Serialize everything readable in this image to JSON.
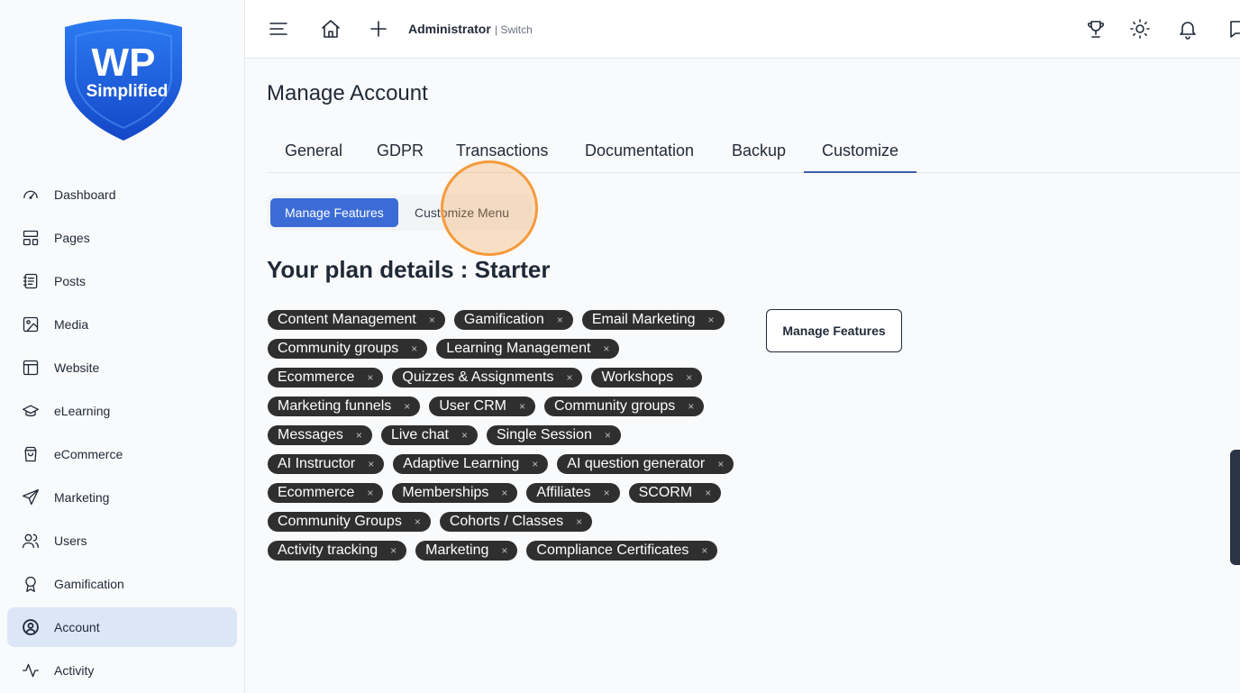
{
  "brand": {
    "logo_main": "WP",
    "logo_sub": "Simplified",
    "color": "#1f5fe0"
  },
  "sidebar": {
    "items": [
      {
        "label": "Dashboard",
        "icon": "gauge-icon"
      },
      {
        "label": "Pages",
        "icon": "layout-icon"
      },
      {
        "label": "Posts",
        "icon": "notebook-icon"
      },
      {
        "label": "Media",
        "icon": "image-icon"
      },
      {
        "label": "Website",
        "icon": "browser-icon"
      },
      {
        "label": "eLearning",
        "icon": "graduation-cap-icon"
      },
      {
        "label": "eCommerce",
        "icon": "shopping-bag-icon"
      },
      {
        "label": "Marketing",
        "icon": "paper-plane-icon"
      },
      {
        "label": "Users",
        "icon": "users-icon"
      },
      {
        "label": "Gamification",
        "icon": "award-icon"
      },
      {
        "label": "Account",
        "icon": "user-circle-icon",
        "active": true
      },
      {
        "label": "Activity",
        "icon": "activity-icon"
      }
    ]
  },
  "topbar": {
    "user": "Administrator",
    "switch_label": "| Switch"
  },
  "page": {
    "title": "Manage Account",
    "tabs": [
      {
        "label": "General"
      },
      {
        "label": "GDPR"
      },
      {
        "label": "Transactions"
      },
      {
        "label": "Documentation"
      },
      {
        "label": "Backup"
      },
      {
        "label": "Customize",
        "active": true
      }
    ],
    "subtabs": [
      {
        "label": "Manage Features",
        "active": true
      },
      {
        "label": "Customize Menu"
      }
    ],
    "plan_heading": "Your plan details : Starter",
    "features": [
      [
        "Content Management",
        "Gamification",
        "Email Marketing"
      ],
      [
        "Community groups",
        "Learning Management"
      ],
      [
        "Ecommerce",
        "Quizzes & Assignments",
        "Workshops"
      ],
      [
        "Marketing funnels",
        "User CRM",
        "Community groups"
      ],
      [
        "Messages",
        "Live chat",
        "Single Session"
      ],
      [
        "AI Instructor",
        "Adaptive Learning",
        "AI question generator"
      ],
      [
        "Ecommerce",
        "Memberships",
        "Affiliates",
        "SCORM"
      ],
      [
        "Community Groups",
        "Cohorts / Classes"
      ],
      [
        "Activity tracking",
        "Marketing",
        "Compliance Certificates"
      ]
    ],
    "chip_remove_glyph": "×",
    "manage_features_button": "Manage Features"
  },
  "colors": {
    "accent": "#3b6cd6",
    "chip_bg": "#2f2f2f",
    "highlight": "#f59a3b",
    "active_nav_bg": "#dbe6f7"
  }
}
